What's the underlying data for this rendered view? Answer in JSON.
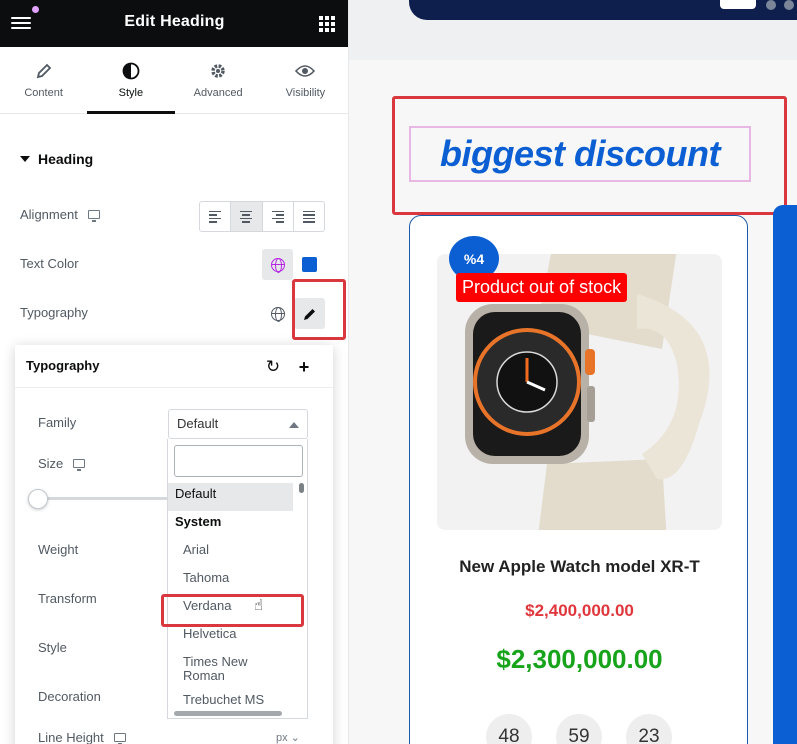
{
  "editor": {
    "title": "Edit Heading",
    "tabs": [
      {
        "label": "Content",
        "icon": "pencil-icon"
      },
      {
        "label": "Style",
        "icon": "half-circle-icon"
      },
      {
        "label": "Advanced",
        "icon": "gear-icon"
      },
      {
        "label": "Visibility",
        "icon": "eye-icon"
      }
    ],
    "active_tab": "Style",
    "section": "Heading",
    "alignment_label": "Alignment",
    "text_color_label": "Text Color",
    "typography_label": "Typography",
    "text_color_value": "#0b5fd3"
  },
  "typography": {
    "title": "Typography",
    "family_label": "Family",
    "family_value": "Default",
    "size_label": "Size",
    "weight_label": "Weight",
    "transform_label": "Transform",
    "style_label": "Style",
    "decoration_label": "Decoration",
    "line_height_label": "Line Height",
    "line_height_unit": "px",
    "dropdown": {
      "search_value": "",
      "options": [
        "Default",
        "System",
        "Arial",
        "Tahoma",
        "Verdana",
        "Helvetica",
        "Times New Roman",
        "Trebuchet MS"
      ],
      "hovered": "Verdana"
    }
  },
  "canvas": {
    "heading": "biggest discount",
    "product": {
      "discount_badge": "%4",
      "stock_label": "Product out of stock",
      "name": "New Apple Watch model XR-T",
      "old_price": "$2,400,000.00",
      "new_price": "$2,300,000.00",
      "countdown": [
        "48",
        "59",
        "23"
      ]
    }
  },
  "colors": {
    "accent": "#0b5fd3",
    "highlight_box": "#d9383e",
    "old_price": "#e0373c",
    "new_price": "#17a31a",
    "stock_badge": "#ff0000"
  }
}
